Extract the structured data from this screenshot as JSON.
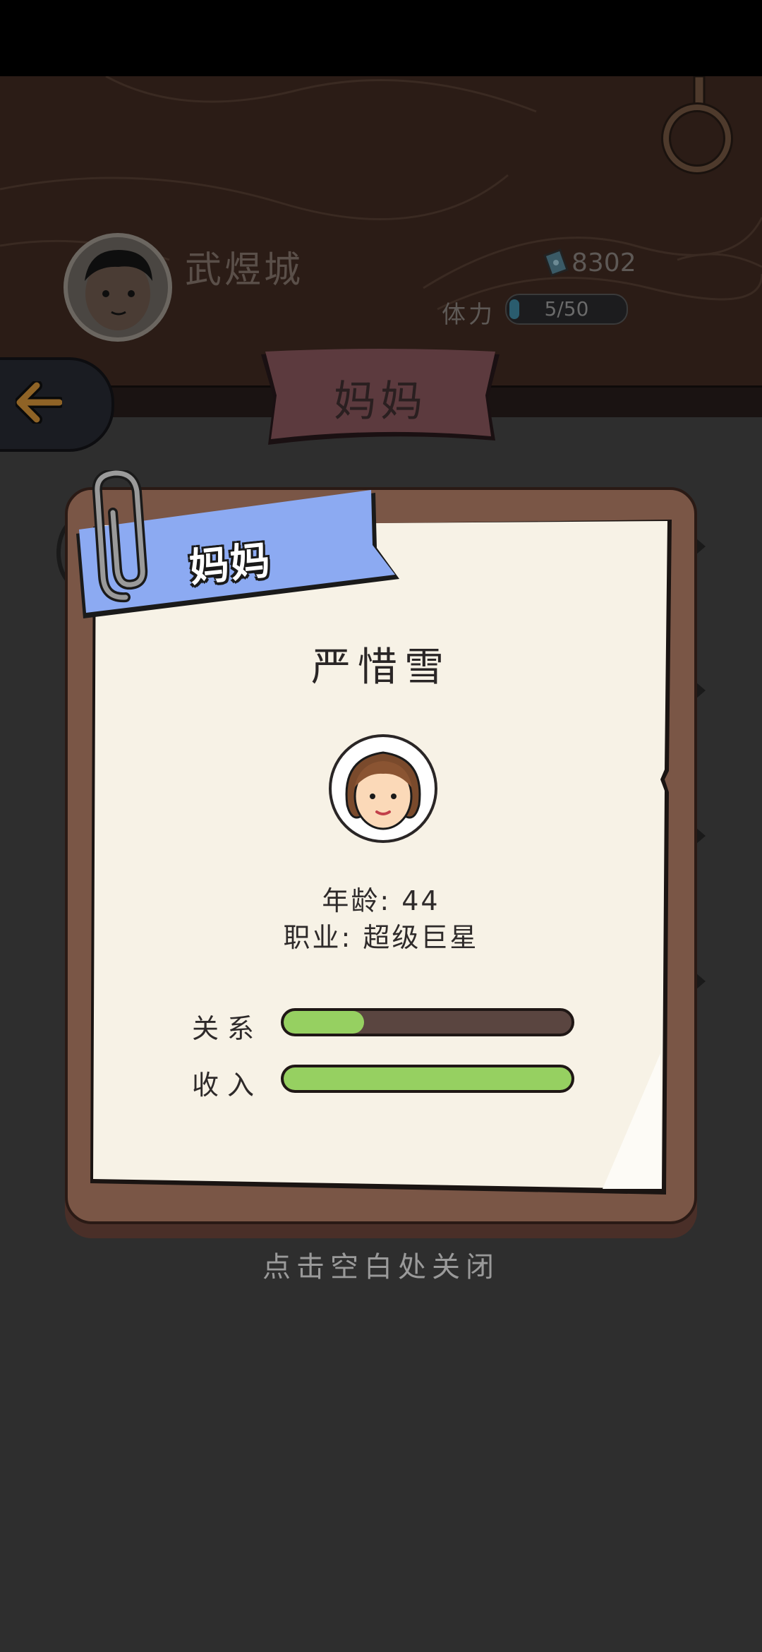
{
  "header": {
    "player_name": "武煜城",
    "money": "8302",
    "stamina_label": "体力",
    "stamina_value": "5/50",
    "stamina_fraction": 0.1
  },
  "page_title": "妈妈",
  "card": {
    "ribbon_label": "妈妈",
    "name": "严惜雪",
    "age_line": "年龄: 44",
    "job_line": "职业: 超级巨星",
    "stats": [
      {
        "label": "关系",
        "value": 0.28
      },
      {
        "label": "收入",
        "value": 1.0
      }
    ]
  },
  "close_hint": "点击空白处关闭",
  "colors": {
    "ribbon": "#8caaf2",
    "stat_fill": "#96d061",
    "frame": "#7a5646",
    "title_banner": "#5c3a3e"
  },
  "icons": [
    "back-arrow-icon",
    "money-icon",
    "player-avatar",
    "character-portrait",
    "paperclip-icon"
  ]
}
